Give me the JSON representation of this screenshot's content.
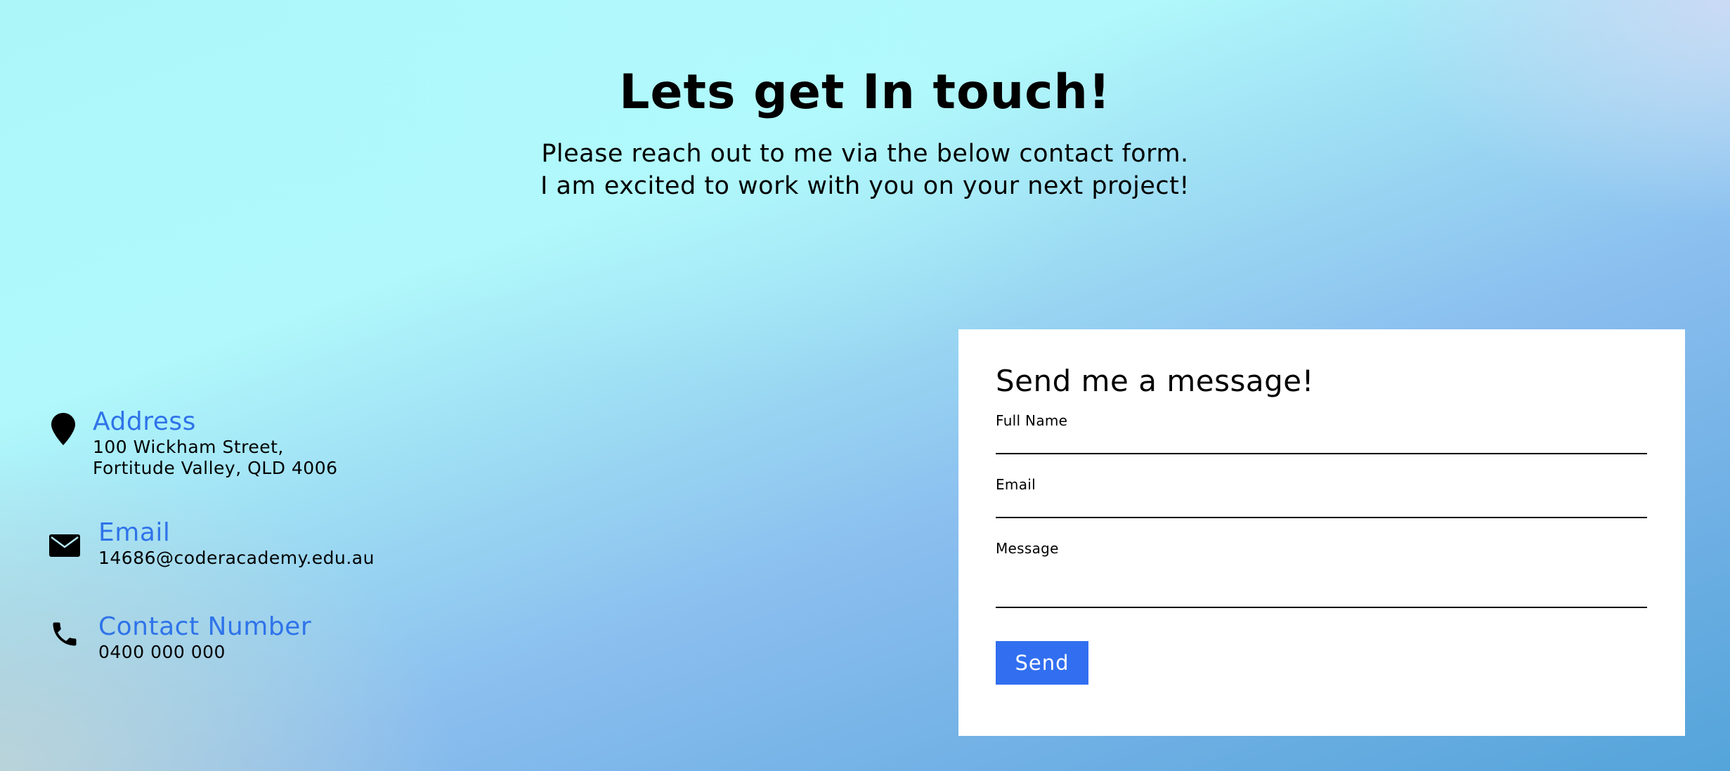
{
  "hero": {
    "title": "Lets get In touch!",
    "subtitle_line1": "Please reach out to me via the below contact form.",
    "subtitle_line2": "I am excited to work with you on your next project!"
  },
  "contact_info": {
    "address": {
      "icon": "map-pin-icon",
      "title": "Address",
      "line1": "100 Wickham Street,",
      "line2": "Fortitude Valley, QLD 4006"
    },
    "email": {
      "icon": "envelope-icon",
      "title": "Email",
      "value": "14686@coderacademy.edu.au"
    },
    "phone": {
      "icon": "phone-icon",
      "title": "Contact Number",
      "value": "0400 000 000"
    }
  },
  "form": {
    "title": "Send me a message!",
    "full_name_label": "Full Name",
    "email_label": "Email",
    "message_label": "Message",
    "send_label": "Send"
  },
  "colors": {
    "accent": "#316ff0",
    "heading_accent": "#2f73e9"
  }
}
